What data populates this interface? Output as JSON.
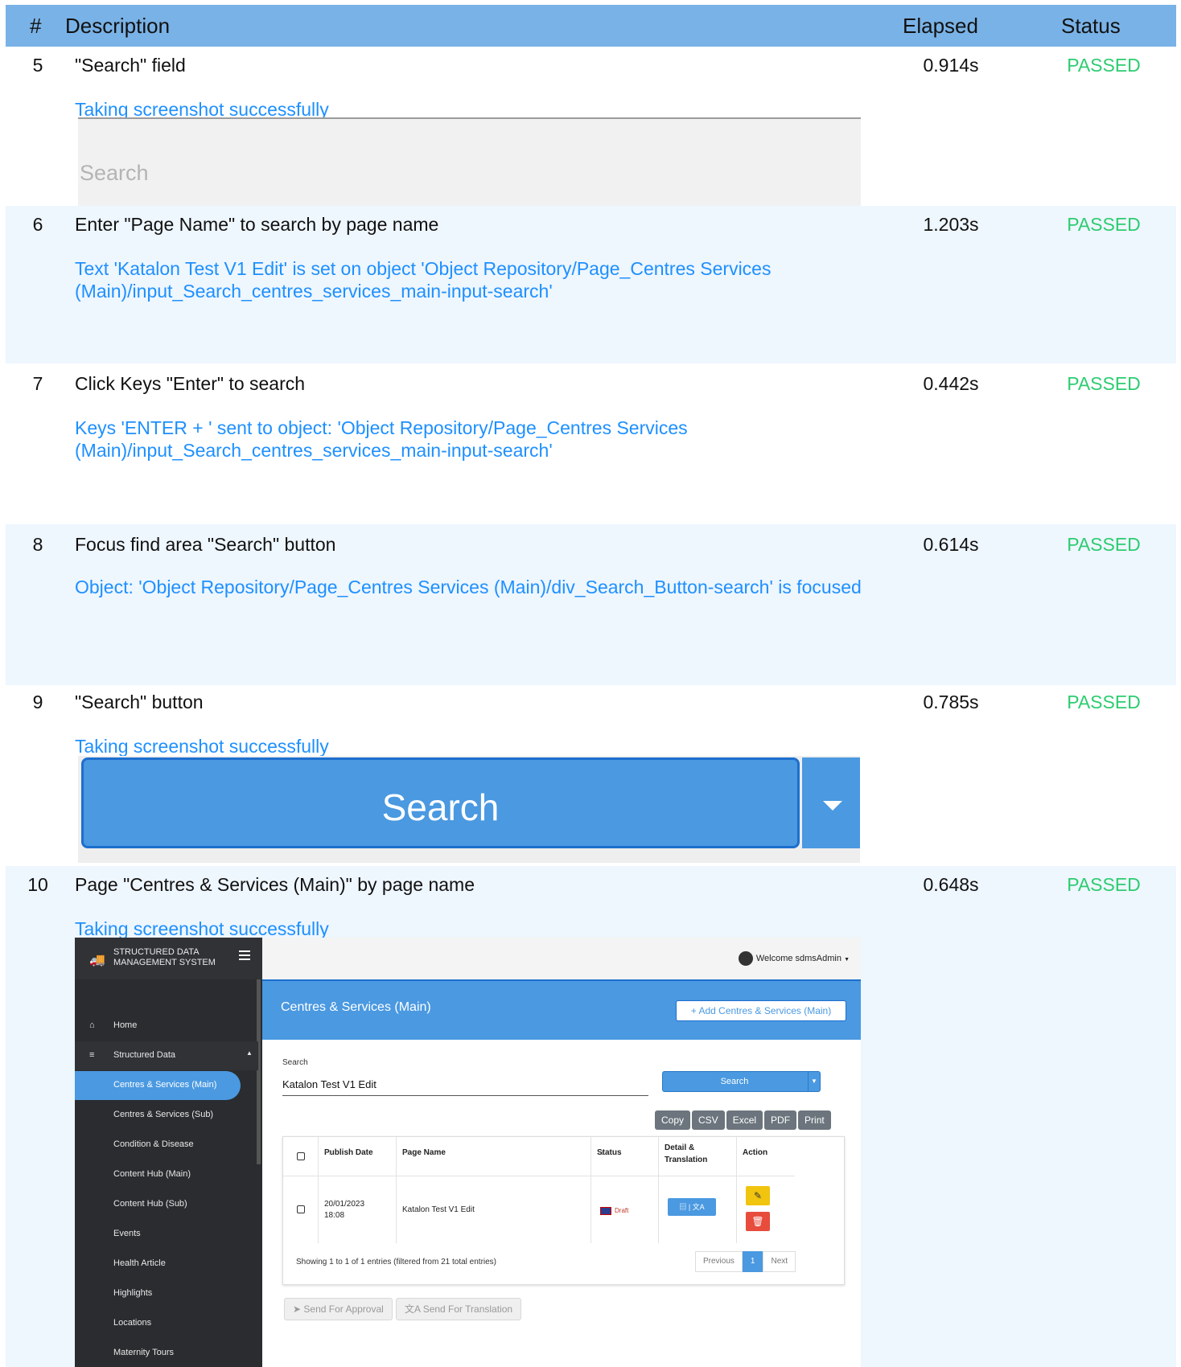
{
  "header": {
    "num": "#",
    "description": "Description",
    "elapsed": "Elapsed",
    "status": "Status"
  },
  "steps": [
    {
      "num": "5",
      "description": "\"Search\" field",
      "elapsed": "0.914s",
      "status": "PASSED",
      "log": "Taking screenshot successfully"
    },
    {
      "num": "6",
      "description": "Enter \"Page Name\" to search by page name",
      "elapsed": "1.203s",
      "status": "PASSED",
      "log": "Text 'Katalon Test V1 Edit' is set on object 'Object Repository/Page_Centres  Services (Main)/input_Search_centres_services_main-input-search'"
    },
    {
      "num": "7",
      "description": "Click Keys \"Enter\" to search",
      "elapsed": "0.442s",
      "status": "PASSED",
      "log": "Keys 'ENTER + ' sent to object: 'Object Repository/Page_Centres  Services (Main)/input_Search_centres_services_main-input-search'"
    },
    {
      "num": "8",
      "description": "Focus find area \"Search\" button",
      "elapsed": "0.614s",
      "status": "PASSED",
      "log": "Object: 'Object Repository/Page_Centres  Services (Main)/div_Search_Button-search' is focused"
    },
    {
      "num": "9",
      "description": "\"Search\" button",
      "elapsed": "0.785s",
      "status": "PASSED",
      "log": "Taking screenshot successfully"
    },
    {
      "num": "10",
      "description": "Page \"Centres & Services (Main)\" by page name",
      "elapsed": "0.648s",
      "status": "PASSED",
      "log": "Taking screenshot successfully"
    }
  ],
  "screenshot_search_field": {
    "placeholder": "Search"
  },
  "screenshot_search_button": {
    "label": "Search"
  },
  "app": {
    "brand": "STRUCTURED DATA\nMANAGEMENT SYSTEM",
    "welcome": "Welcome sdmsAdmin",
    "sidebar": {
      "home": "Home",
      "group": "Structured Data",
      "items": [
        "Centres & Services (Main)",
        "Centres & Services (Sub)",
        "Condition & Disease",
        "Content Hub (Main)",
        "Content Hub (Sub)",
        "Events",
        "Health Article",
        "Highlights",
        "Locations",
        "Maternity Tours"
      ]
    },
    "page_title": "Centres & Services (Main)",
    "add_button": "+ Add Centres & Services (Main)",
    "search_label": "Search",
    "search_value": "Katalon Test V1 Edit",
    "search_button": "Search",
    "export_buttons": [
      "Copy",
      "CSV",
      "Excel",
      "PDF",
      "Print"
    ],
    "table": {
      "headers": [
        "Publish Date",
        "Page Name",
        "Status",
        "Detail &\nTranslation",
        "Action"
      ],
      "row": {
        "publish_date": "20/01/2023\n18:08",
        "page_name": "Katalon Test V1 Edit",
        "status": "Draft"
      }
    },
    "footer_info": "Showing 1 to 1 of 1 entries (filtered from 21 total entries)",
    "pagination": {
      "previous": "Previous",
      "page": "1",
      "next": "Next"
    },
    "bottom_buttons": [
      "Send For Approval",
      "Send For Translation"
    ]
  }
}
